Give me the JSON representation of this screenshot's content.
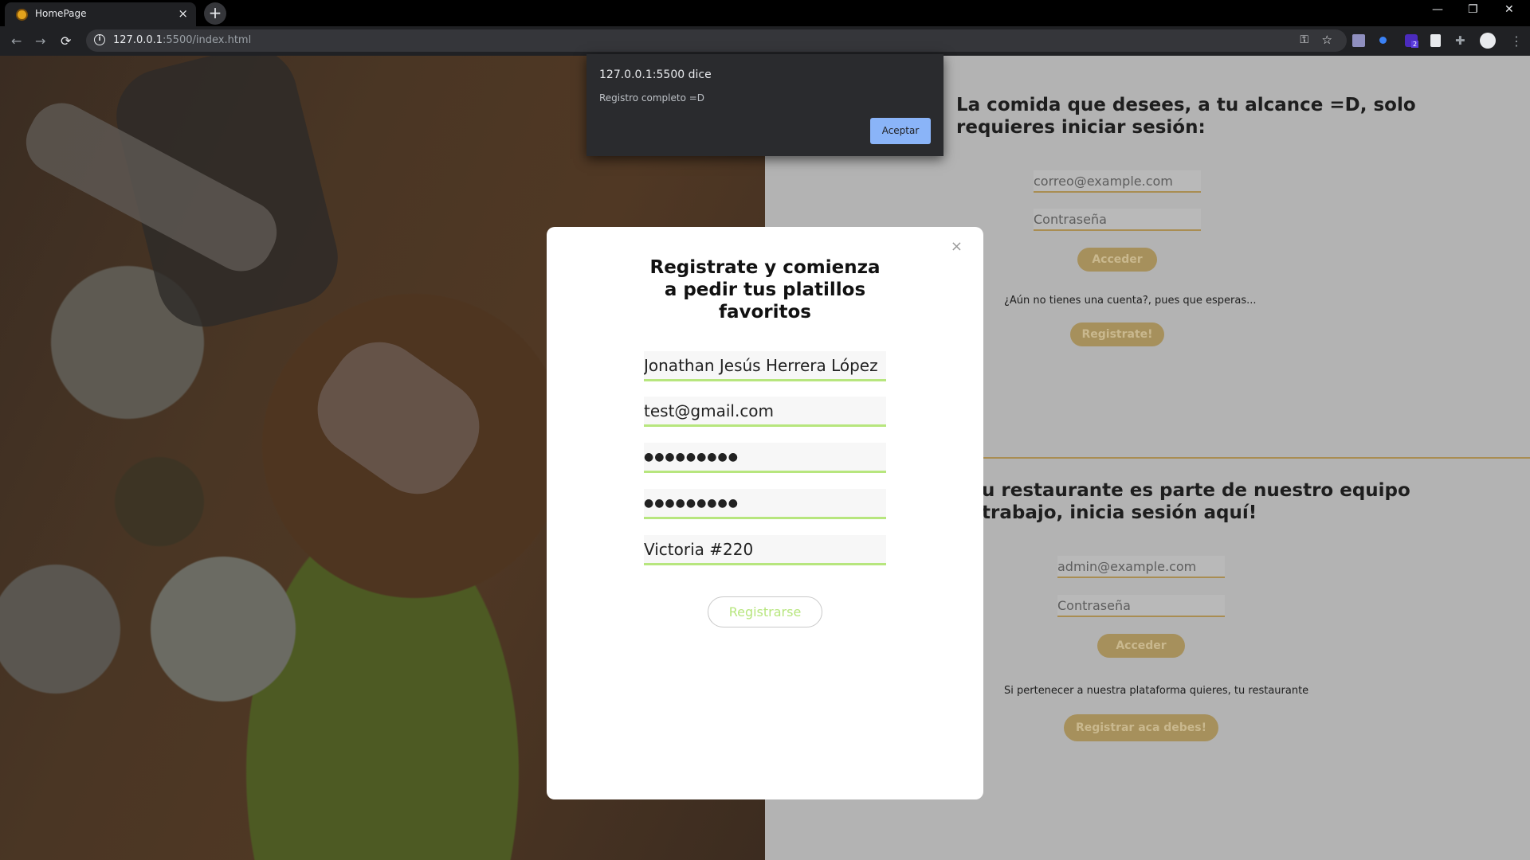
{
  "browser": {
    "tab_title": "HomePage",
    "tab_close": "×",
    "new_tab": "+",
    "url_host": "127.0.0.1",
    "url_rest": ":5500/index.html",
    "window_minimize": "—",
    "window_restore": "❐",
    "window_close": "✕",
    "back_icon": "←",
    "forward_icon": "→",
    "reload_icon": "⟳",
    "info_icon": "i",
    "key_icon": "⚿",
    "star_icon": "☆",
    "menu_icon": "⋮",
    "ext_badge": "2"
  },
  "alert": {
    "title": "127.0.0.1:5500 dice",
    "message": "Registro completo =D",
    "ok_label": "Aceptar"
  },
  "customer_section": {
    "title_line1": "La comida que desees, a tu alcance =D, solo",
    "title_line2": "requieres iniciar sesión:",
    "email_placeholder": "correo@example.com",
    "password_placeholder": "Contraseña",
    "login_label": "Acceder",
    "no_account_text": "¿Aún no tienes una cuenta?, pues que esperas...",
    "register_label": "Registrate!"
  },
  "restaurant_section": {
    "title_line1": "u restaurante es parte de nuestro equipo",
    "title_line2": "trabajo, inicia sesión aquí!",
    "email_placeholder": "admin@example.com",
    "password_placeholder": "Contraseña",
    "login_label": "Acceder",
    "belong_text": "Si pertenecer a nuestra plataforma quieres, tu restaurante",
    "register_label": "Registrar aca debes!"
  },
  "modal": {
    "close_label": "×",
    "title": "Registrate y comienza a pedir tus platillos favoritos",
    "name_value": "Jonathan Jesús Herrera López",
    "email_value": "test@gmail.com",
    "password_value": "●●●●●●●●●",
    "confirm_password_value": "●●●●●●●●●",
    "address_value": "Victoria #220",
    "submit_label": "Registrarse"
  },
  "colors": {
    "accent_gold": "#a98d52",
    "accent_green": "#b7e67e",
    "alert_button": "#8ab4f8"
  }
}
